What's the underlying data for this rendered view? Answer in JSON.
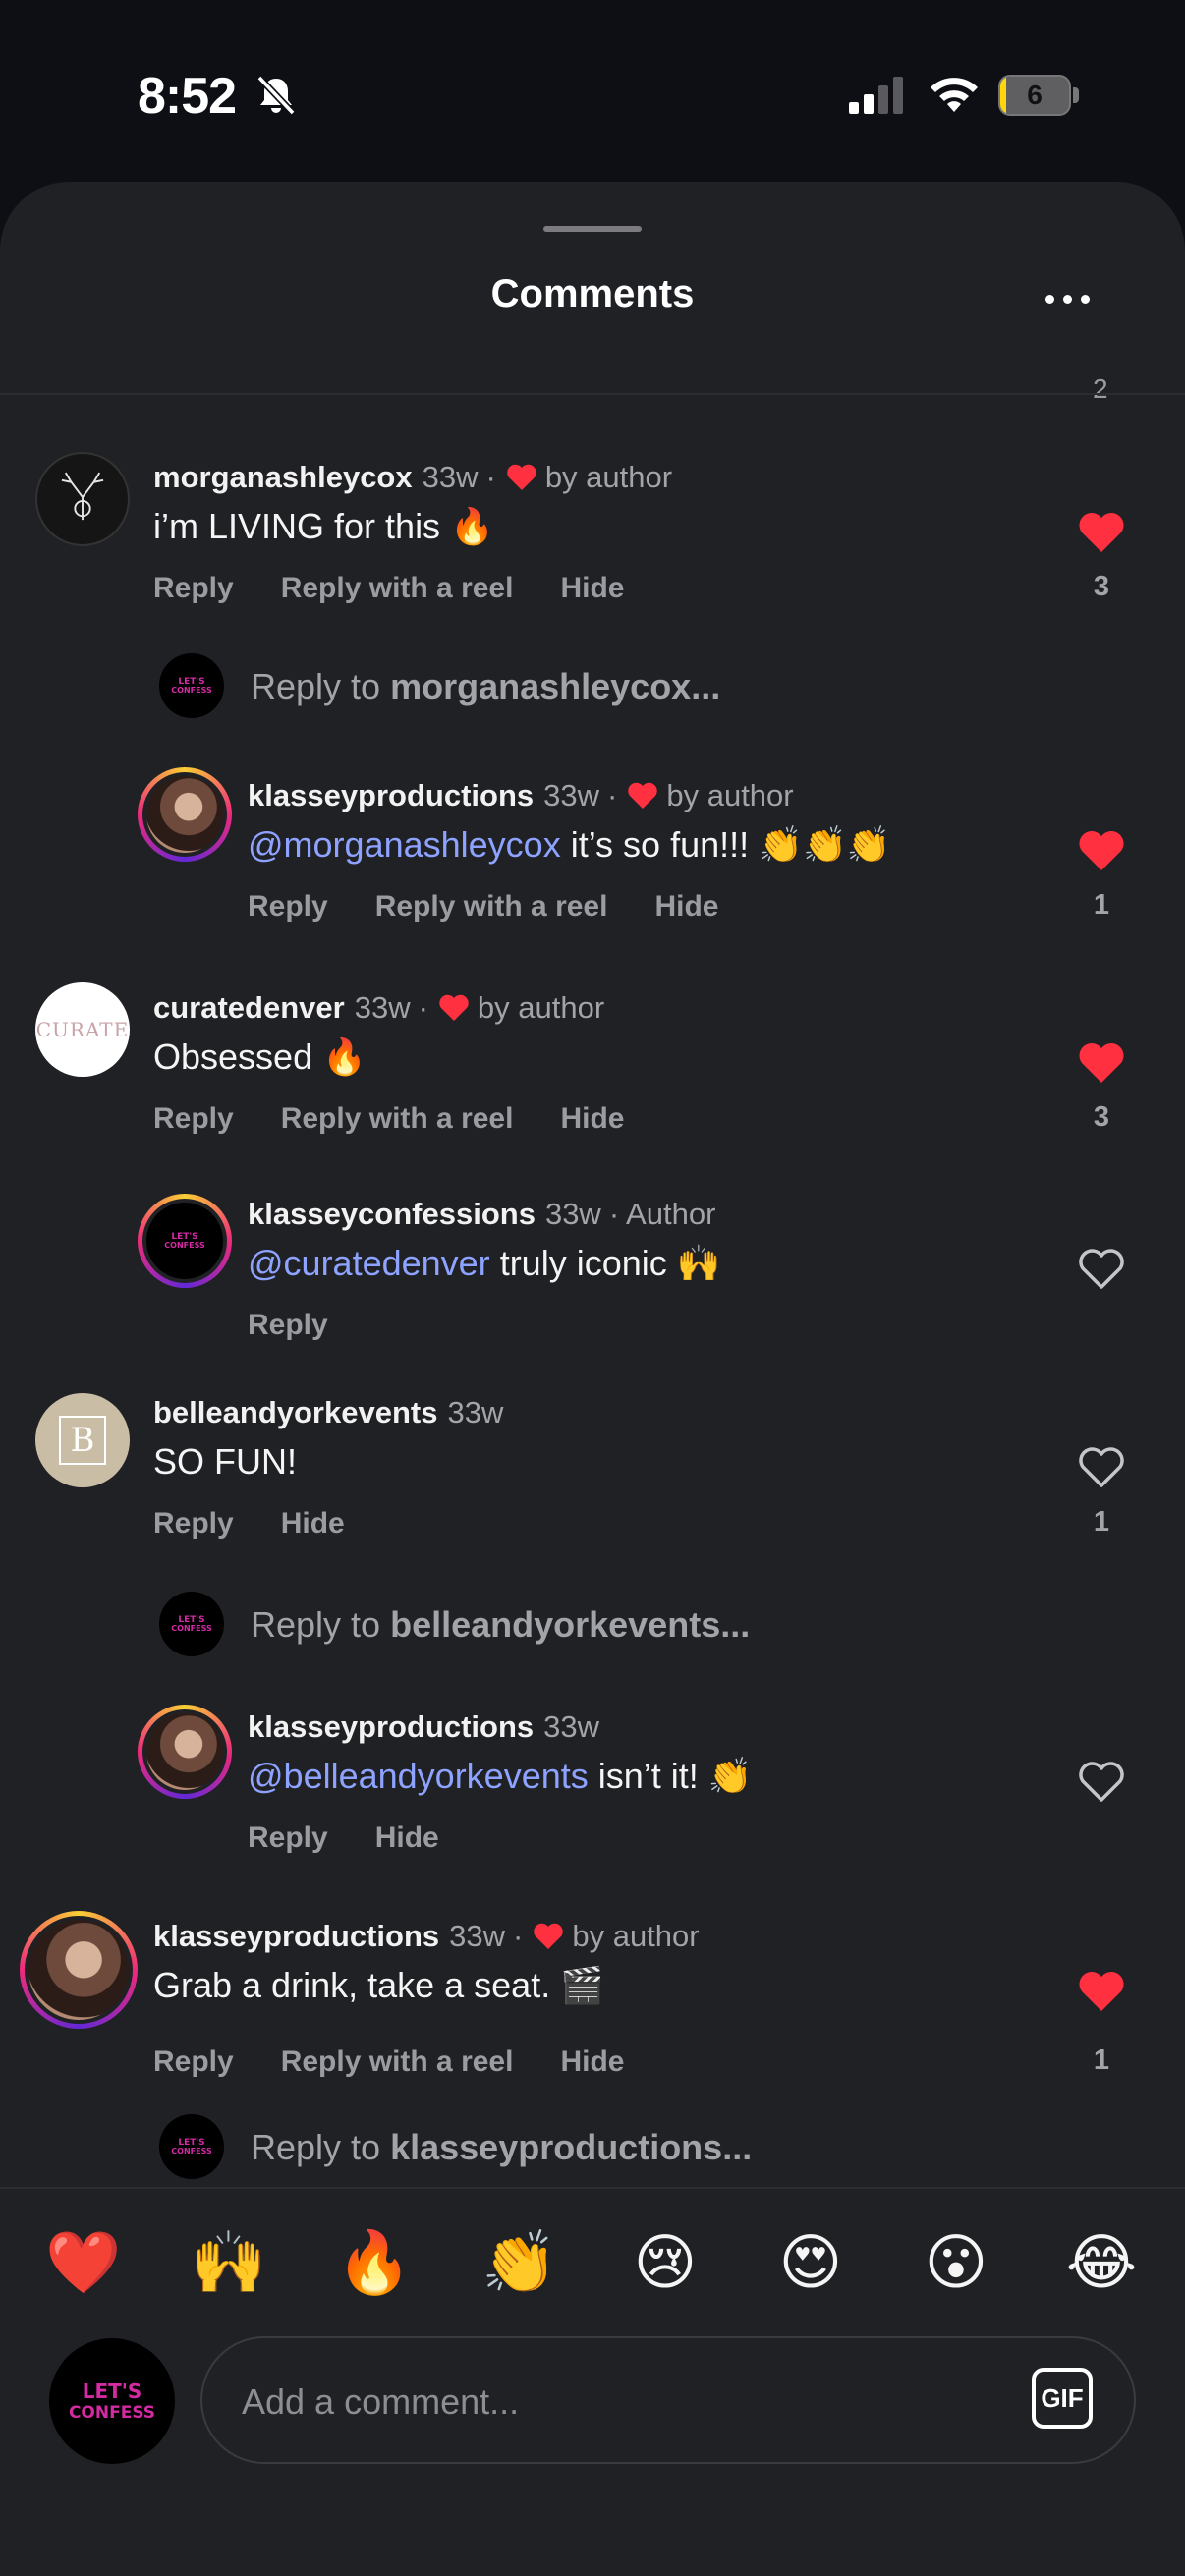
{
  "status_bar": {
    "time": "8:52",
    "battery": "6",
    "battery_fraction": 0.06
  },
  "sheet": {
    "title": "Comments",
    "previous_count": "2"
  },
  "comments": [
    {
      "username": "morganashleycox",
      "time": "33w",
      "liked_by_author": true,
      "author_label": "by author",
      "text": "i’m LIVING for this 🔥",
      "actions": [
        "Reply",
        "Reply with a reel",
        "Hide"
      ],
      "liked": true,
      "like_count": "3"
    },
    {
      "username": "klasseyproductions",
      "time": "33w",
      "liked_by_author": true,
      "author_label": "by author",
      "mention": "@morganashleycox",
      "text": " it’s so fun!!! 👏👏👏",
      "actions": [
        "Reply",
        "Reply with a reel",
        "Hide"
      ],
      "liked": true,
      "like_count": "1"
    },
    {
      "username": "curatedenver",
      "time": "33w",
      "liked_by_author": true,
      "author_label": "by author",
      "text": "Obsessed 🔥",
      "actions": [
        "Reply",
        "Reply with a reel",
        "Hide"
      ],
      "liked": true,
      "like_count": "3"
    },
    {
      "username": "klasseyconfessions",
      "time": "33w",
      "author_tag": "· Author",
      "mention": "@curatedenver",
      "text": " truly iconic 🙌",
      "actions": [
        "Reply"
      ],
      "liked": false
    },
    {
      "username": "belleandyorkevents",
      "time": "33w",
      "text": "SO FUN!",
      "actions": [
        "Reply",
        "Hide"
      ],
      "liked": false,
      "like_count": "1"
    },
    {
      "username": "klasseyproductions",
      "time": "33w",
      "mention": "@belleandyorkevents",
      "text": " isn’t it! 👏",
      "actions": [
        "Reply",
        "Hide"
      ],
      "liked": false
    },
    {
      "username": "klasseyproductions",
      "time": "33w",
      "liked_by_author": true,
      "author_label": "by author",
      "text": "Grab a drink, take a seat. 🎬",
      "actions": [
        "Reply",
        "Reply with a reel",
        "Hide"
      ],
      "liked": true,
      "like_count": "1"
    }
  ],
  "reply_prompts": [
    {
      "prefix": "Reply to ",
      "target": "morganashleycox..."
    },
    {
      "prefix": "Reply to ",
      "target": "belleandyorkevents..."
    },
    {
      "prefix": "Reply to ",
      "target": "klasseyproductions..."
    }
  ],
  "avatar_text": {
    "confess": "LET'S CONFESS",
    "curate": "CURATE",
    "belle": "B"
  },
  "reactions": [
    "❤️",
    "🙌",
    "🔥",
    "👏",
    "😢",
    "😍",
    "😮",
    "😂"
  ],
  "composer": {
    "placeholder": "Add a comment...",
    "gif_label": "GIF"
  },
  "colors": {
    "like_red": "#ff3040",
    "mention": "#8ea2ff",
    "background": "#202125"
  }
}
